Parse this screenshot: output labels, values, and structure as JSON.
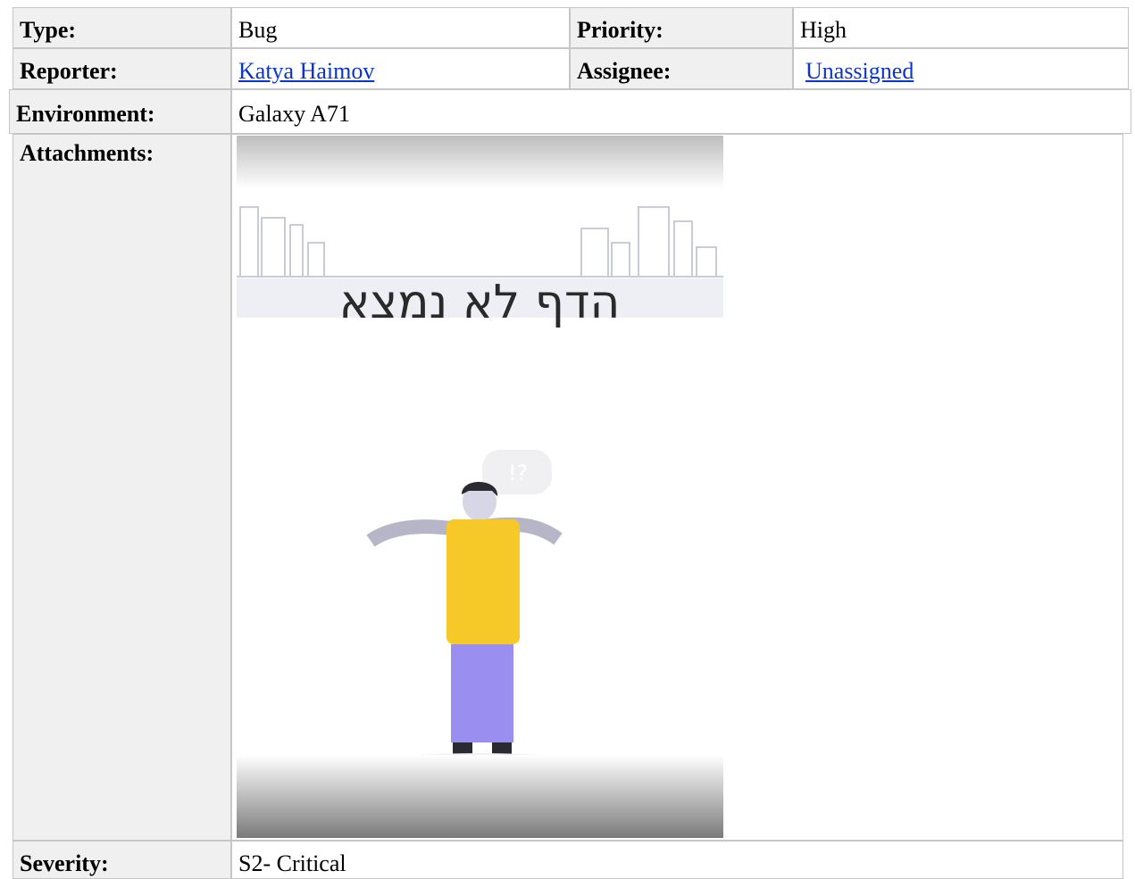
{
  "issue": {
    "type": {
      "label": "Type:",
      "value": "Bug"
    },
    "priority": {
      "label": "Priority:",
      "value": "High"
    },
    "reporter": {
      "label": "Reporter:",
      "value": "Katya Haimov"
    },
    "assignee": {
      "label": "Assignee:",
      "value": "Unassigned"
    },
    "environment": {
      "label": "Environment:",
      "value": "Galaxy A71"
    },
    "attachments": {
      "label": "Attachments:",
      "image": {
        "text": "הדף לא נמצא",
        "text_color": "#2a2a2a",
        "shirt_color": "#f7c928",
        "pants_color": "#9a8ef0"
      }
    },
    "severity": {
      "label": "Severity:",
      "value": "S2- Critical"
    }
  },
  "colors": {
    "link": "#0b35c8",
    "label_bg": "#f0f0f0",
    "border": "#c6c6c6"
  }
}
